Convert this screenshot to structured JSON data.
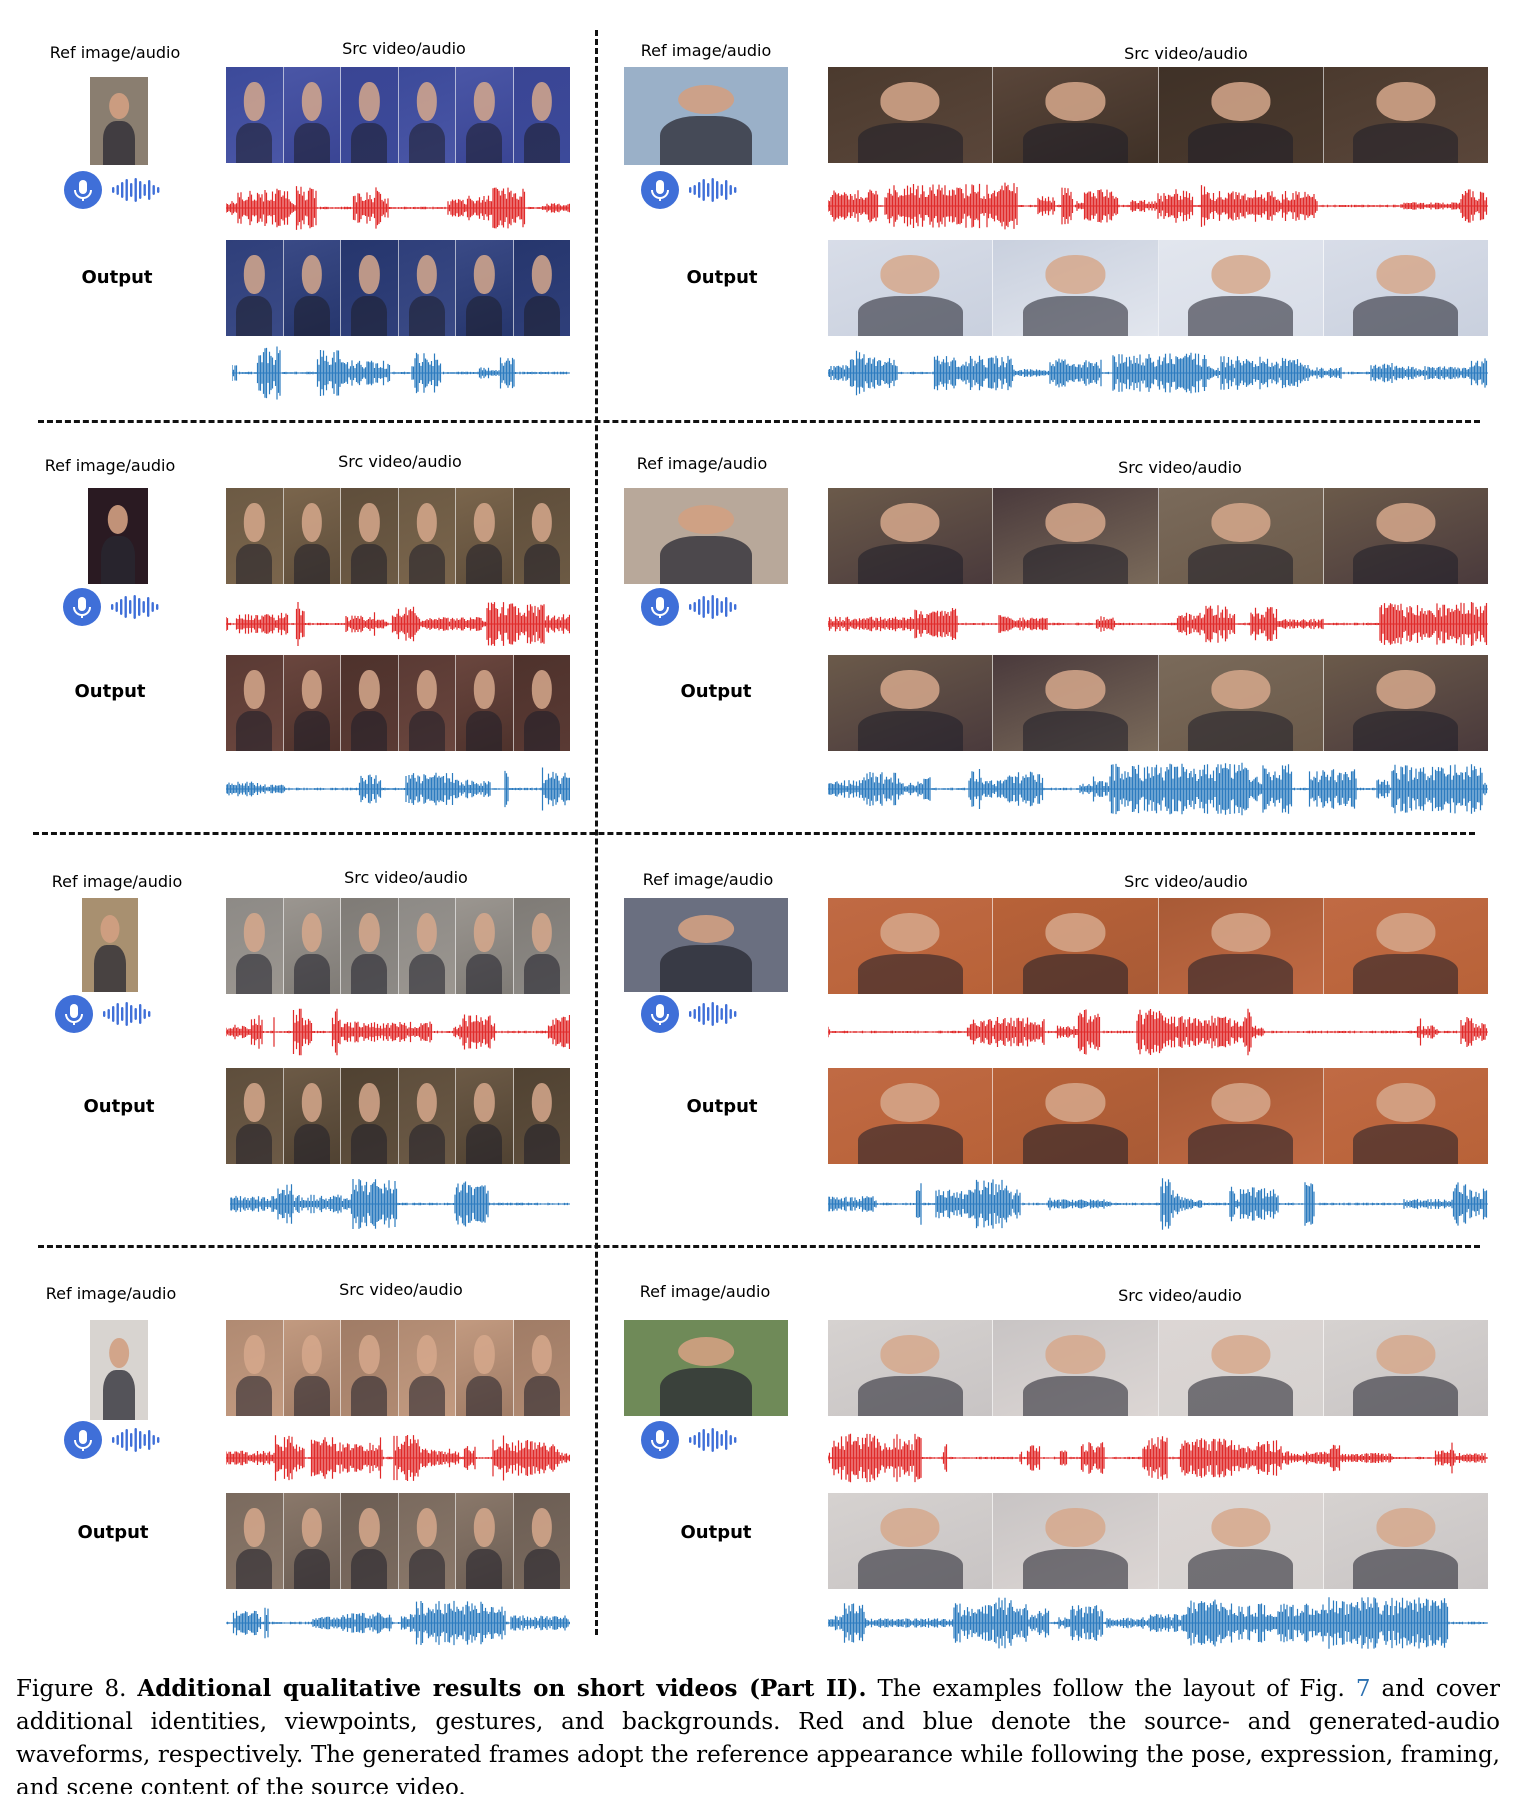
{
  "labels": {
    "ref": "Ref image/audio",
    "src": "Src video/audio",
    "output": "Output"
  },
  "colors": {
    "source_waveform": "#e02a2a",
    "generated_waveform": "#2c7bbf",
    "mic_accent": "#3f6fd8"
  },
  "icons": [
    "mic-icon",
    "audio-bars-icon"
  ],
  "panels": [
    {
      "id": "r1-left",
      "ref_color": "#8a7e70",
      "src_colors": [
        "#3c4a9a",
        "#4a56a6",
        "#3a4594"
      ],
      "out_colors": [
        "#2f3f7a",
        "#3a4a86",
        "#26366d"
      ]
    },
    {
      "id": "r1-right",
      "ref_color": "#9ab0c8",
      "src_colors": [
        "#4b3a2e",
        "#5a463a",
        "#3f3127"
      ],
      "out_colors": [
        "#d8dde8",
        "#c9d0de",
        "#e2e6ee"
      ]
    },
    {
      "id": "r2-left",
      "ref_color": "#2a1a22",
      "src_colors": [
        "#6c5a44",
        "#7a654c",
        "#5f4e3b"
      ],
      "out_colors": [
        "#5a3a34",
        "#6a463e",
        "#4e322c"
      ]
    },
    {
      "id": "r2-right",
      "ref_color": "#b8a89a",
      "src_colors": [
        "#6b5a4a",
        "#4a3a3c",
        "#7a6a5a"
      ],
      "out_colors": [
        "#6b5a4a",
        "#4a3a3c",
        "#7a6a5a"
      ]
    },
    {
      "id": "r3-left",
      "ref_color": "#a89070",
      "src_colors": [
        "#8d8a86",
        "#9b9690",
        "#7f7b76"
      ],
      "out_colors": [
        "#5e4e3c",
        "#6c5a46",
        "#504232"
      ]
    },
    {
      "id": "r3-right",
      "ref_color": "#6a6f80",
      "src_colors": [
        "#c06a44",
        "#b86238",
        "#a85a36"
      ],
      "out_colors": [
        "#c06a44",
        "#b86238",
        "#a85a36"
      ]
    },
    {
      "id": "r4-left",
      "ref_color": "#d8d4d0",
      "src_colors": [
        "#b08a72",
        "#c29a80",
        "#a07c66"
      ],
      "out_colors": [
        "#7a6a5e",
        "#8a786a",
        "#6c5e54"
      ]
    },
    {
      "id": "r4-right",
      "ref_color": "#6f8a58",
      "src_colors": [
        "#d6d2d0",
        "#c8c4c4",
        "#dcd6d4"
      ],
      "out_colors": [
        "#d6d2d0",
        "#c8c4c4",
        "#dcd6d4"
      ]
    }
  ],
  "caption": {
    "figure_label": "Figure 8.",
    "title": "Additional qualitative results on short videos (Part II).",
    "text_before_ref": "The examples follow the layout of Fig.",
    "fig_ref": "7",
    "text_after_ref": "and cover additional identities, viewpoints, gestures, and backgrounds. Red and blue denote the source- and generated-audio waveforms, respectively. The generated frames adopt the reference appearance while following the pose, expression, framing, and scene content of the source video."
  }
}
